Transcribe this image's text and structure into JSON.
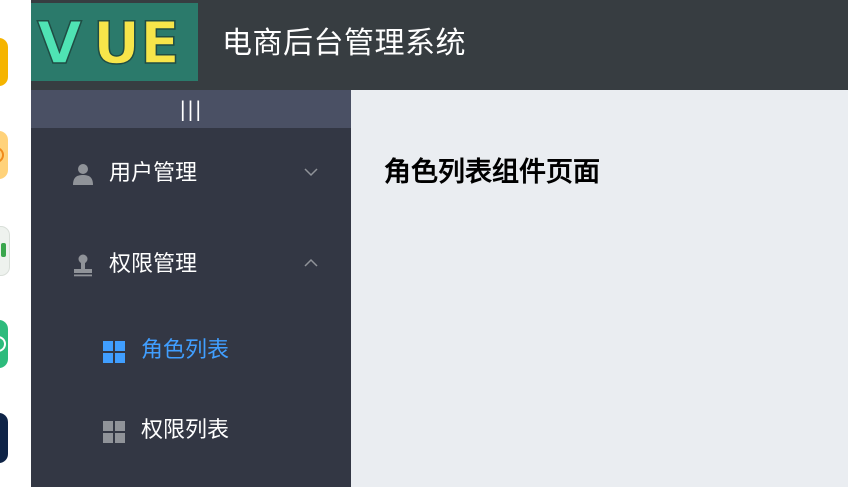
{
  "header": {
    "logo_text": "VUE",
    "title": "电商后台管理系统"
  },
  "sidebar": {
    "toggle_label": "|||",
    "menus": [
      {
        "label": "用户管理",
        "icon": "user-icon",
        "expanded": false,
        "children": []
      },
      {
        "label": "权限管理",
        "icon": "stamp-icon",
        "expanded": true,
        "children": [
          {
            "label": "角色列表",
            "icon": "grid-icon",
            "active": true
          },
          {
            "label": "权限列表",
            "icon": "grid-icon",
            "active": false
          }
        ]
      }
    ]
  },
  "main": {
    "heading": "角色列表组件页面"
  },
  "colors": {
    "header_bg": "#373d41",
    "sidebar_bg": "#333744",
    "toggle_bg": "#4a5064",
    "main_bg": "#eaedf1",
    "active": "#409eff",
    "icon_gray": "#909399"
  }
}
